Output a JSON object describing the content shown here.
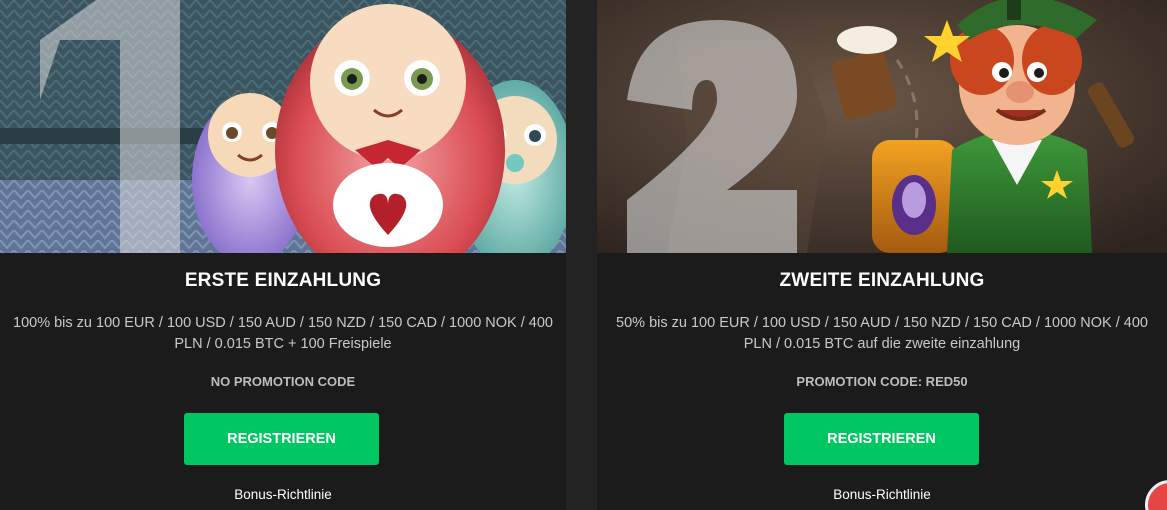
{
  "cards": [
    {
      "number": "1",
      "title": "ERSTE EINZAHLUNG",
      "description": "100% bis zu 100 EUR / 100 USD / 150 AUD / 150 NZD / 150 CAD / 1000 NOK / 400 PLN / 0.015 BTC + 100 Freispiele",
      "promo": "NO PROMOTION CODE",
      "button_label": "REGISTRIEREN",
      "link_label": "Bonus-Richtlinie"
    },
    {
      "number": "2",
      "title": "ZWEITE EINZAHLUNG",
      "description": "50% bis zu 100 EUR / 100 USD / 150 AUD / 150 NZD / 150 CAD / 1000 NOK / 400 PLN / 0.015 BTC auf die zweite einzahlung",
      "promo": "PROMOTION CODE: RED50",
      "button_label": "REGISTRIEREN",
      "link_label": "Bonus-Richtlinie"
    }
  ],
  "colors": {
    "button": "#00c762",
    "card_bg": "#1b1b1b",
    "page_bg": "#232323"
  }
}
